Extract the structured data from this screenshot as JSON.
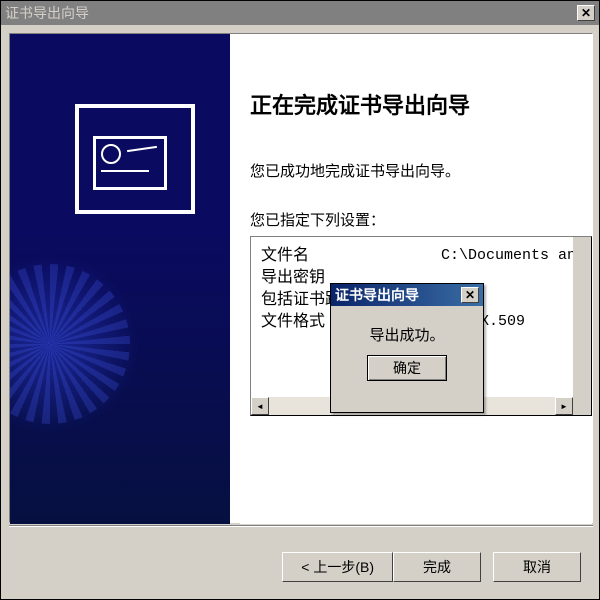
{
  "window": {
    "title": "证书导出向导",
    "close_glyph": "✕"
  },
  "main": {
    "heading": "正在完成证书导出向导",
    "success_text": "您已成功地完成证书导出向导。",
    "settings_label": "您已指定下列设置：",
    "rows": [
      {
        "label": "文件名",
        "value": "C:\\Documents and Set"
      },
      {
        "label": "导出密钥",
        "value": ""
      },
      {
        "label": "包括证书路径中",
        "value": ""
      },
      {
        "label": "文件格式",
        "value": "进制 X.509"
      }
    ],
    "scroll": {
      "left": "◄",
      "right": "►"
    }
  },
  "buttons": {
    "back": "< 上一步(B)",
    "finish": "完成",
    "cancel": "取消"
  },
  "msgbox": {
    "title": "证书导出向导",
    "body": "导出成功。",
    "ok": "确定",
    "close_glyph": "✕"
  }
}
